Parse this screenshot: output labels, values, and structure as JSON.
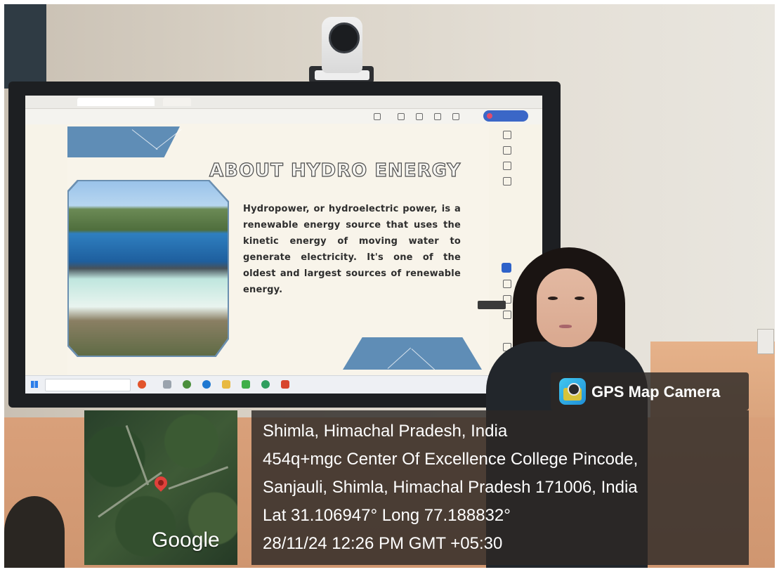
{
  "slide": {
    "title": "ABOUT HYDRO ENERGY",
    "body": "Hydropower, or hydroelectric power, is a renewable energy source that uses the kinetic energy of moving water to generate electricity. It's one of the oldest and largest sources of renewable energy."
  },
  "overlay": {
    "app_name": "GPS Map Camera",
    "map_logo": "Google",
    "location_title": "Shimla, Himachal Pradesh, India",
    "address_line_1": "454q+mgc Center Of Excellence College Pincode,",
    "address_line_2": "Sanjauli, Shimla, Himachal Pradesh 171006, India",
    "coordinates": "Lat 31.106947° Long 77.188832°",
    "datetime": "28/11/24 12:26 PM GMT +05:30"
  },
  "colors": {
    "slide_accent": "#5f8db6",
    "overlay_bg": "#2c2826",
    "map_pin": "#e0413b",
    "toolbar_accent": "#3b67c7"
  },
  "icons": [
    "gps-camera-icon",
    "map-pin-icon",
    "windows-start-icon"
  ]
}
